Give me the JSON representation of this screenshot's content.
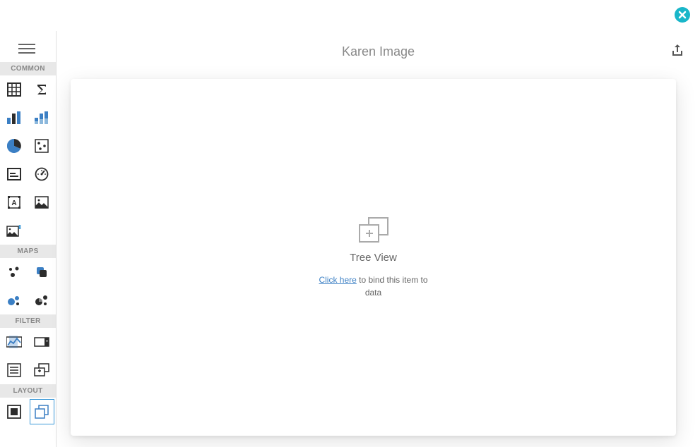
{
  "header": {
    "title": "Karen Image"
  },
  "sidebar": {
    "sections": {
      "common": "COMMON",
      "maps": "MAPS",
      "filter": "FILTER",
      "layout": "LAYOUT"
    }
  },
  "placeholder": {
    "title": "Tree View",
    "link_text": "Click here",
    "suffix_text": " to bind this item to data"
  },
  "colors": {
    "accent": "#3b99d8",
    "close": "#19b6c9",
    "icon_dark": "#2c2c2c",
    "icon_blue": "#3b7fc4",
    "muted": "#888"
  }
}
